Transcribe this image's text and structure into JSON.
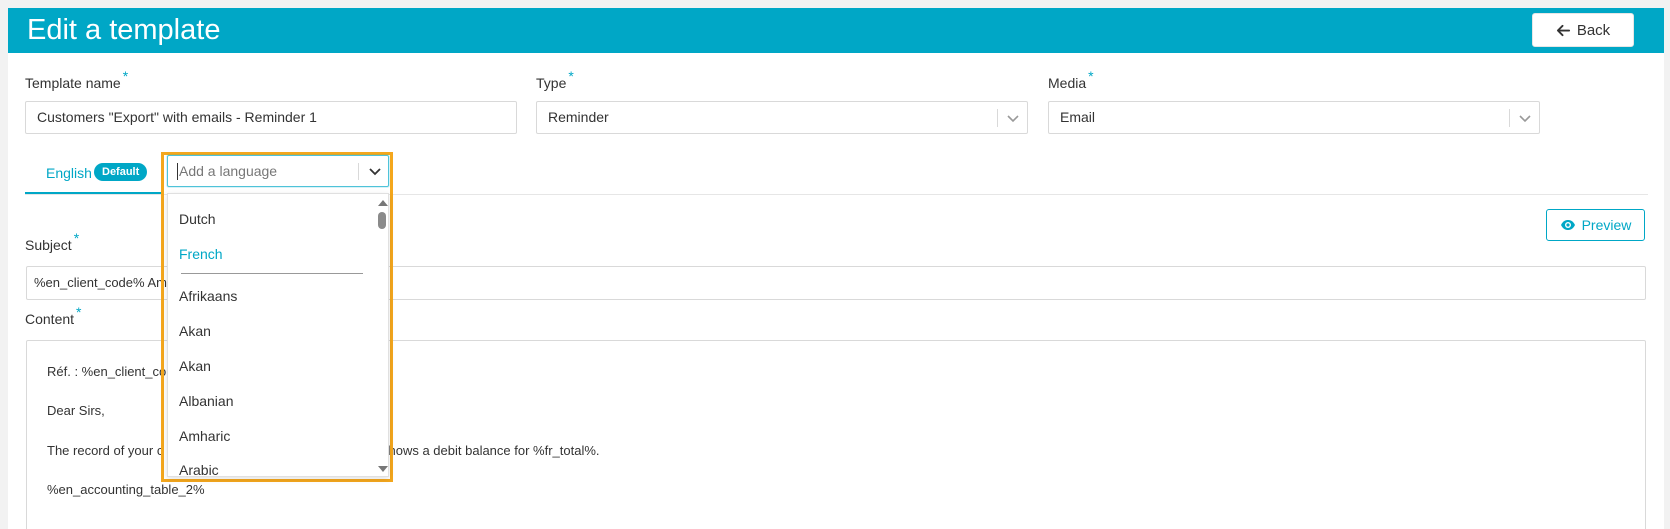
{
  "header": {
    "title": "Edit a template",
    "back_label": "Back"
  },
  "form": {
    "template_name": {
      "label": "Template name",
      "required": "*",
      "value": "Customers \"Export\" with emails - Reminder 1"
    },
    "type": {
      "label": "Type",
      "required": "*",
      "value": "Reminder"
    },
    "media": {
      "label": "Media",
      "required": "*",
      "value": "Email"
    }
  },
  "tabs": {
    "active_label": "English",
    "badge": "Default"
  },
  "language_select": {
    "placeholder": "Add a language",
    "options_top": [
      "Dutch",
      "French"
    ],
    "selected_option": "French",
    "options": [
      "Afrikaans",
      "Akan",
      "Akan",
      "Albanian",
      "Amharic",
      "Arabic"
    ]
  },
  "preview_label": "Preview",
  "subject": {
    "label": "Subject",
    "required": "*",
    "value": "%en_client_code% Am"
  },
  "content": {
    "label": "Content",
    "required": "*",
    "lines": [
      "Réf. : %en_client_co",
      "Dear Sirs,",
      "The record of your c",
      "shows a debit balance for %fr_total%.",
      "%en_accounting_table_2%"
    ]
  },
  "colors": {
    "accent": "#00a7c6",
    "highlight": "#f4a71d"
  }
}
